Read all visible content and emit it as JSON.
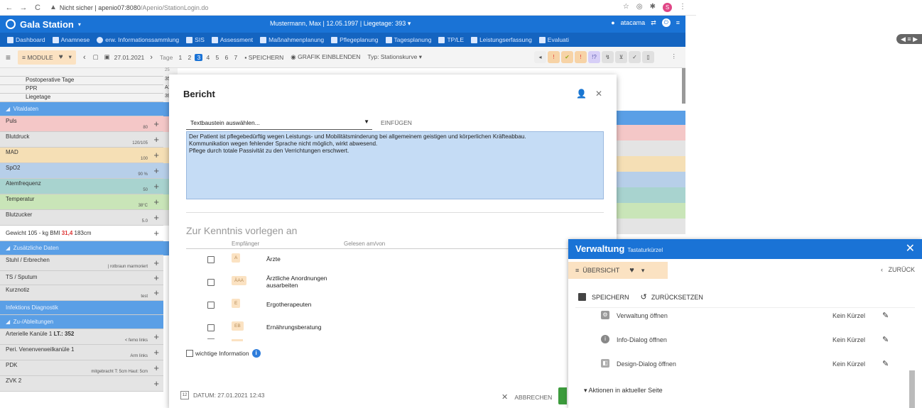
{
  "browser": {
    "insecure": "Nicht sicher",
    "url_host": "apenio07:8080",
    "url_path": "/Apenio/StationLogin.do",
    "avatar": "S"
  },
  "app": {
    "title": "Gala Station",
    "patient": "Mustermann, Max | 12.05.1997 | Liegetage: 393",
    "user": "atacama"
  },
  "nav": [
    "Dashboard",
    "Anamnese",
    "erw. Informationssammlung",
    "SIS",
    "Assessment",
    "Maßnahmenplanung",
    "Pflegeplanung",
    "Tagesplanung",
    "TP/LE",
    "Leistungserfassung",
    "Evaluati"
  ],
  "toolbar": {
    "module": "MODULE",
    "date": "27.01.2021",
    "tage": "Tage",
    "days": [
      "1",
      "2",
      "3",
      "4",
      "5",
      "6",
      "7"
    ],
    "save": "SPEICHERN",
    "grafik": "GRAFIK EINBLENDEN",
    "typ": "Typ: Stationskurve"
  },
  "side": {
    "r1": "Postoperative Tage",
    "r2": "PPR",
    "r3": "Liegetage",
    "vital": "Vitaldaten",
    "puls": "Puls",
    "puls_v": "80",
    "blut": "Blutdruck",
    "blut_v": "120/105",
    "mad": "MAD",
    "mad_v": "100",
    "spo2": "SpO2",
    "spo2_v": "90 %",
    "atem": "Atemfrequenz",
    "atem_v": "50",
    "temp": "Temperatur",
    "temp_v": "38°C",
    "bz": "Blutzucker",
    "bz_v": "5.0",
    "gewicht_a": "Gewicht 105 - kg BMI ",
    "gewicht_bmi": "31,4",
    "gewicht_b": " 183cm",
    "zus": "Zusätzliche Daten",
    "stuhl": "Stuhl / Erbrechen",
    "stuhl_v": "| rotbraun marmoriert",
    "ts": "TS / Sputum",
    "kurz": "Kurznotiz",
    "kurz_v": "test",
    "inf": "Infektions Diagnostik",
    "zu": "Zu-/Ableitungen",
    "art": "Arterielle Kanüle 1 ",
    "art_b": "LT.: 352",
    "art_v": "< femo links",
    "peri": "Peri. Venenverweilkanüle 1",
    "peri_v": "Arm links",
    "pdk": "PDK",
    "pdk_v": "mitgebracht T: 5cm Haut: 5cm",
    "zvk": "ZVK 2"
  },
  "gridnums": {
    "a": "25",
    "b": "35",
    "c": "A1",
    "d": "39"
  },
  "dialog": {
    "title": "Bericht",
    "select": "Textbaustein auswählen...",
    "insert": "EINFÜGEN",
    "text1": "Der Patient ist pflegebedürftig wegen Leistungs- und Mobilitätsminderung bei allgemeinem geistigen und körperlichen Kräfteabbau.",
    "text2": "Kommunikation wegen fehlender Sprache nicht möglich, wirkt abwesend.",
    "text3": "Pflege durch totale Passivität zu den Verrichtungen erschwert.",
    "kenntnis": "Zur Kenntnis vorlegen an",
    "col1": "Empfänger",
    "col2": "Gelesen am/von",
    "recipients": [
      {
        "tag": "A",
        "name": "Ärzte"
      },
      {
        "tag": "ÄAA",
        "name": "Ärztliche Anordnungen",
        "name2": "ausarbeiten"
      },
      {
        "tag": "E",
        "name": "Ergotherapeuten"
      },
      {
        "tag": "EB",
        "name": "Ernährungsberatung"
      }
    ],
    "wichtig": "wichtige Information",
    "datum": "DATUM: 27.01.2021 12:43",
    "abbrechen": "ABBRECHEN"
  },
  "verw": {
    "title": "Verwaltung",
    "sub": "Tastaturkürzel",
    "uebersicht": "ÜBERSICHT",
    "zurueck": "ZURÜCK",
    "save": "SPEICHERN",
    "reset": "ZURÜCKSETZEN",
    "items": [
      {
        "label": "Verwaltung öffnen",
        "kz": "Kein Kürzel"
      },
      {
        "label": "Info-Dialog öffnen",
        "kz": "Kein Kürzel"
      },
      {
        "label": "Design-Dialog öffnen",
        "kz": "Kein Kürzel"
      }
    ],
    "aktionen": "Aktionen in aktueller Seite"
  },
  "colors": {
    "primary": "#1a73d6",
    "orange_tag": "#fbe2c2",
    "text_blue": "#c5dcf5"
  }
}
